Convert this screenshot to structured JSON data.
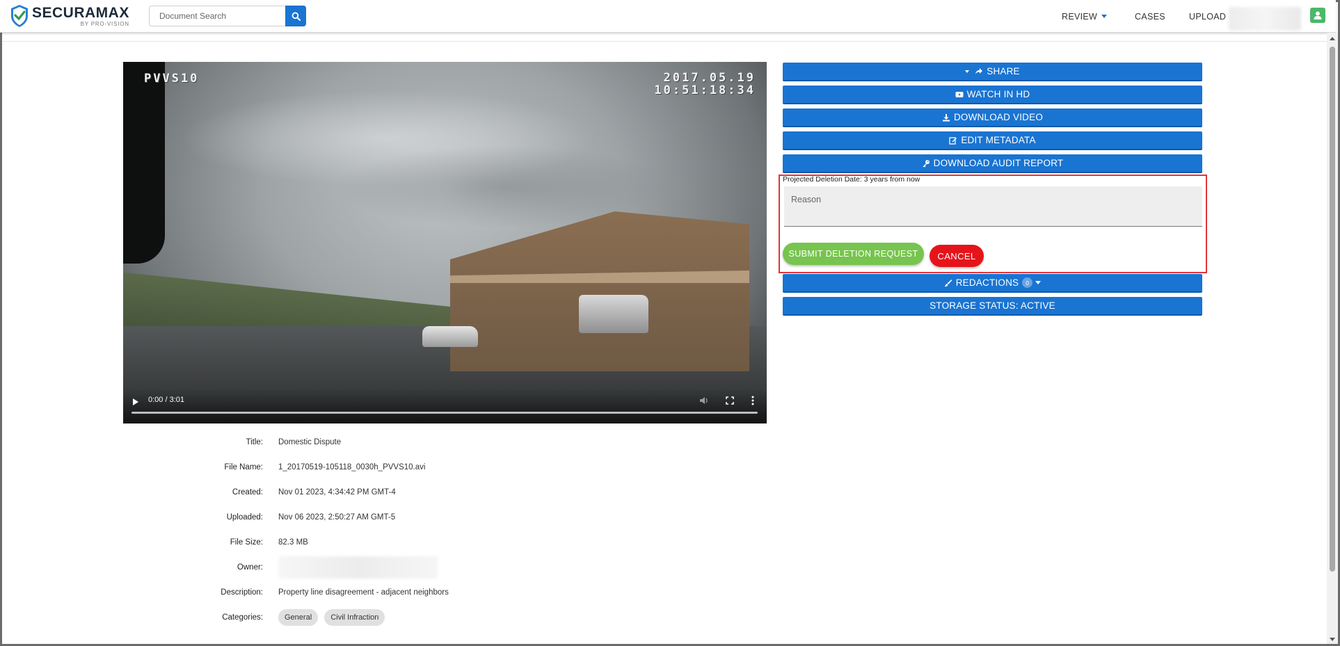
{
  "header": {
    "brand": "SECURAMAX",
    "brand_sub": "BY PRO-VISION",
    "search_placeholder": "Document Search",
    "nav": {
      "review": "REVIEW",
      "cases": "CASES",
      "upload": "UPLOAD"
    }
  },
  "video": {
    "camera_label": "PVVS10",
    "osd_date": "2017.05.19",
    "osd_time": "10:51:18:34",
    "time_display": "0:00 / 3:01",
    "progress_fraction": 0.0
  },
  "actions": {
    "share": "SHARE",
    "watch_hd": "WATCH IN HD",
    "download_video": "DOWNLOAD VIDEO",
    "edit_metadata": "EDIT METADATA",
    "download_audit": "DOWNLOAD AUDIT REPORT",
    "redactions": "REDACTIONS",
    "redactions_count": "0",
    "storage_status": "STORAGE STATUS: ACTIVE"
  },
  "deletion": {
    "projected_date": "Projected Deletion Date: 3 years from now",
    "reason_placeholder": "Reason",
    "submit_label": "SUBMIT DELETION REQUEST",
    "cancel_label": "CANCEL"
  },
  "metadata": {
    "title_label": "Title:",
    "title_value": "Domestic Dispute",
    "filename_label": "File Name:",
    "filename_value": "1_20170519-105118_0030h_PVVS10.avi",
    "created_label": "Created:",
    "created_value": "Nov 01 2023, 4:34:42 PM GMT-4",
    "uploaded_label": "Uploaded:",
    "uploaded_value": "Nov 06 2023, 2:50:27 AM GMT-5",
    "filesize_label": "File Size:",
    "filesize_value": "82.3 MB",
    "owner_label": "Owner:",
    "description_label": "Description:",
    "description_value": "Property line disagreement - adjacent neighbors",
    "categories_label": "Categories:",
    "categories": [
      "General",
      "Civil Infraction"
    ]
  },
  "colors": {
    "primary": "#1a74d2",
    "submit": "#77c44e",
    "cancel": "#e5141a",
    "highlight_border": "#e0353a"
  }
}
